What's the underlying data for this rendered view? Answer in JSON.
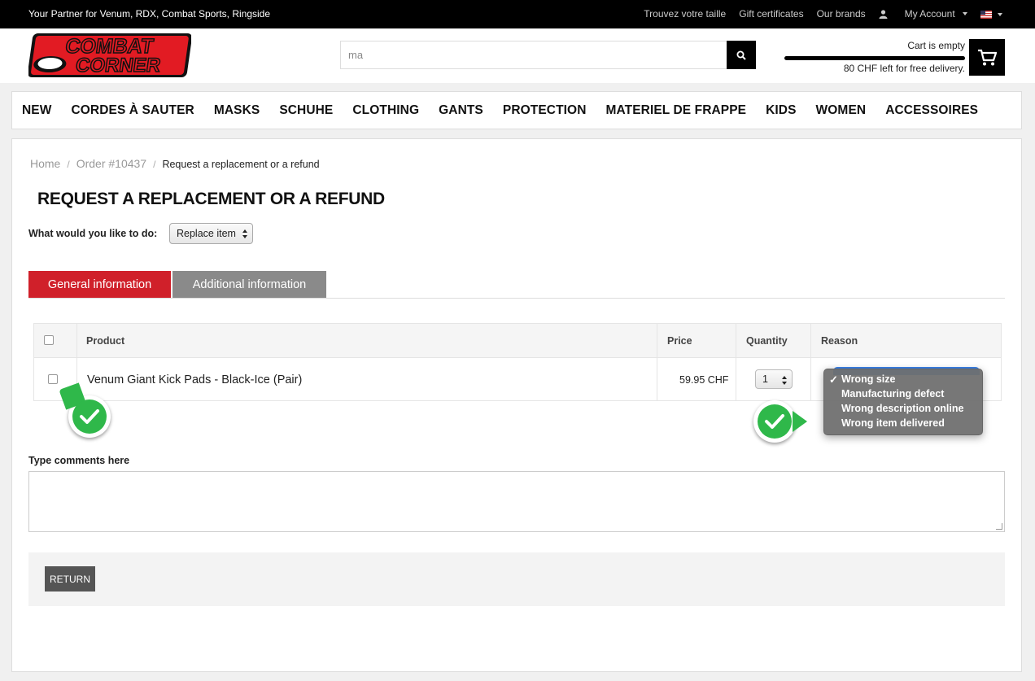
{
  "topbar": {
    "tagline": "Your Partner for Venum, RDX, Combat Sports, Ringside",
    "links": [
      "Trouvez votre taille",
      "Gift certificates",
      "Our brands"
    ],
    "account_label": "My Account",
    "language_flag": "us-flag-icon"
  },
  "header": {
    "logo_line1": "COMBAT",
    "logo_line2": "CORNER",
    "search_value": "ma",
    "cart_status": "Cart is empty",
    "free_delivery_note": "80 CHF left for free delivery."
  },
  "nav": {
    "items": [
      "NEW",
      "CORDES À SAUTER",
      "MASKS",
      "SCHUHE",
      "CLOTHING",
      "GANTS",
      "PROTECTION",
      "MATERIEL DE FRAPPE",
      "KIDS",
      "WOMEN",
      "ACCESSOIRES"
    ]
  },
  "breadcrumb": {
    "home": "Home",
    "order": "Order #10437",
    "current": "Request a replacement or a refund"
  },
  "page": {
    "title": "REQUEST A REPLACEMENT OR A REFUND",
    "action_label": "What would you like to do:",
    "action_value": "Replace item"
  },
  "tabs": {
    "general": "General information",
    "additional": "Additional information"
  },
  "table": {
    "headers": {
      "product": "Product",
      "price": "Price",
      "quantity": "Quantity",
      "reason": "Reason"
    },
    "rows": [
      {
        "product": "Venum Giant Kick Pads - Black-Ice (Pair)",
        "price": "59.95 CHF",
        "quantity": "1"
      }
    ]
  },
  "reason_dropdown": {
    "selected_mark": "✓",
    "options": [
      "Wrong size",
      "Manufacturing defect",
      "Wrong description online",
      "Wrong item delivered"
    ]
  },
  "comments": {
    "label": "Type comments here"
  },
  "footer": {
    "return_label": "RETURN"
  },
  "colors": {
    "accent_red": "#d0202a",
    "tab_grey": "#8a8a8a",
    "marker_green": "#2fb84a"
  }
}
